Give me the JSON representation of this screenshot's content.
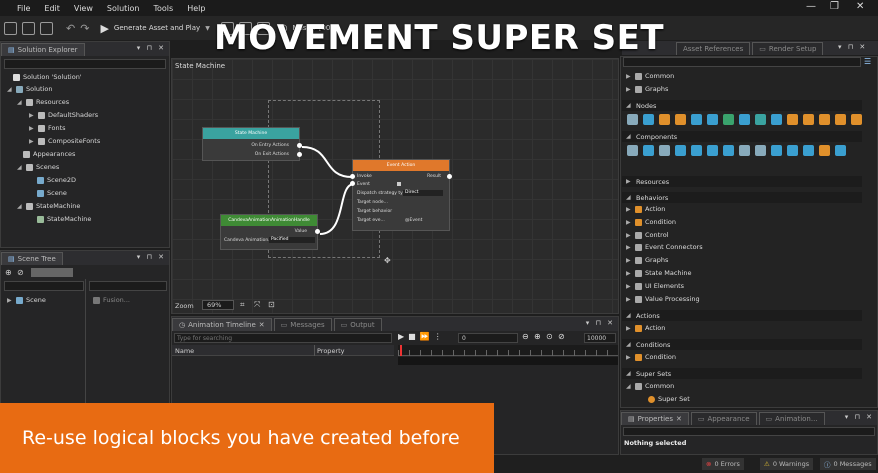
{
  "menu": [
    "File",
    "Edit",
    "View",
    "Solution",
    "Tools",
    "Help"
  ],
  "toolbar": {
    "generate": "Generate Asset and Play",
    "master": "Master [00]"
  },
  "overlay_title": "MOVEMENT SUPER SET",
  "banner_text": "Re-use logical blocks you have created before",
  "solution_explorer": {
    "tab": "Solution Explorer",
    "items": [
      "Solution 'Solution'",
      "Solution",
      "Resources",
      "DefaultShaders",
      "Fonts",
      "CompositeFonts",
      "Appearances",
      "Scenes",
      "Scene2D",
      "Scene",
      "StateMachine",
      "StateMachine"
    ]
  },
  "scene_tree": {
    "tab": "Scene Tree",
    "item": "Scene",
    "right_item": "Fusion..."
  },
  "canvas": {
    "title": "State Machine",
    "zoom_label": "Zoom",
    "zoom_value": "69%",
    "node_state_machine": {
      "title": "State Machine",
      "out1": "On Entry Actions",
      "out2": "On Exit Actions"
    },
    "node_event_action": {
      "title": "Event Action",
      "invoke": "Invoke",
      "result": "Result",
      "event": "Event",
      "dispatch": "Dispatch strategy type",
      "dispatch_val": "Direct",
      "target_node": "Target node...",
      "target_behavior": "Target behavior",
      "target_event": "Target eve...",
      "event_val": "@Event"
    },
    "node_anim": {
      "title": "CandevaAnimationAnimationHandle",
      "value": "Value",
      "row": "Candeva Animation...",
      "row_val": "Pacified"
    }
  },
  "bottom": {
    "tabs": [
      "Animation Timeline",
      "Messages",
      "Output"
    ],
    "search_placeholder": "Type for searching",
    "col_name": "Name",
    "col_property": "Property",
    "time_start": "0",
    "time_end": "10000"
  },
  "right_tabs": [
    "Asset References",
    "Render Setup"
  ],
  "library": {
    "rows_top": [
      "Common",
      "Graphs"
    ],
    "nodes": "Nodes",
    "components": "Components",
    "resources": "Resources",
    "behaviors": "Behaviors",
    "behavior_items": [
      "Action",
      "Condition",
      "Control",
      "Event Connectors",
      "Graphs",
      "State Machine",
      "UI Elements",
      "Value Processing"
    ],
    "actions": "Actions",
    "action_item": "Action",
    "conditions": "Conditions",
    "condition_item": "Condition",
    "super_sets": "Super Sets",
    "super_common": "Common",
    "super_set": "Super Set"
  },
  "properties": {
    "tabs": [
      "Properties",
      "Appearance",
      "Animation..."
    ],
    "status": "Nothing selected"
  },
  "status_bar": {
    "errors": "0 Errors",
    "warnings": "0 Warnings",
    "messages": "0 Messages"
  }
}
